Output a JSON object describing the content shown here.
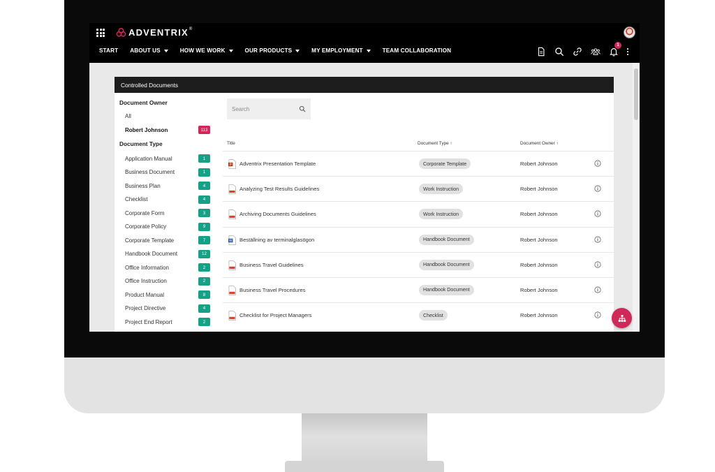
{
  "app": {
    "brand": "ADVENTRIX",
    "trademark": "®"
  },
  "nav": {
    "items": [
      {
        "label": "START",
        "dropdown": false
      },
      {
        "label": "ABOUT US",
        "dropdown": true
      },
      {
        "label": "HOW WE WORK",
        "dropdown": true
      },
      {
        "label": "OUR PRODUCTS",
        "dropdown": true
      },
      {
        "label": "MY EMPLOYMENT",
        "dropdown": true
      },
      {
        "label": "TEAM COLLABORATION",
        "dropdown": false
      }
    ],
    "tools": [
      "document-icon",
      "search-icon",
      "link-icon",
      "people-icon",
      "bell-icon",
      "more-vertical-icon"
    ],
    "notification_count": "1"
  },
  "panel": {
    "title": "Controlled Documents",
    "filters": {
      "owner_heading": "Document Owner",
      "owner_all": "All",
      "owner_selected": {
        "label": "Robert Johnson",
        "count": "113"
      },
      "type_heading": "Document Type",
      "types": [
        {
          "label": "Application Manual",
          "count": "1"
        },
        {
          "label": "Business Document",
          "count": "1"
        },
        {
          "label": "Business Plan",
          "count": "4"
        },
        {
          "label": "Checklist",
          "count": "4"
        },
        {
          "label": "Corporate Form",
          "count": "3"
        },
        {
          "label": "Corporate Policy",
          "count": "9"
        },
        {
          "label": "Corporate Template",
          "count": "7"
        },
        {
          "label": "Handbook Document",
          "count": "12"
        },
        {
          "label": "Office Information",
          "count": "2"
        },
        {
          "label": "Office Instruction",
          "count": "2"
        },
        {
          "label": "Product Manual",
          "count": "8"
        },
        {
          "label": "Project Directive",
          "count": "4"
        },
        {
          "label": "Project End Report",
          "count": "2"
        }
      ]
    },
    "search": {
      "placeholder": "Search"
    },
    "columns": {
      "title": "Title",
      "type": "Document Type ↑",
      "owner": "Document Owner ↑"
    },
    "rows": [
      {
        "title": "Adventrix Presentation Template",
        "type": "Corporate Template",
        "owner": "Robert Johnson",
        "icon": "powerpoint-file-icon"
      },
      {
        "title": "Analyzing Test Results Guidelines",
        "type": "Work Instruction",
        "owner": "Robert Johnson",
        "icon": "pdf-file-icon"
      },
      {
        "title": "Archiving Documents Guidelines",
        "type": "Work Instruction",
        "owner": "Robert Johnson",
        "icon": "pdf-file-icon"
      },
      {
        "title": "Beställning av terminalglasögon",
        "type": "Handbook Document",
        "owner": "Robert Johnson",
        "icon": "word-file-icon"
      },
      {
        "title": "Business Travel Guidelines",
        "type": "Handbook Document",
        "owner": "Robert Johnson",
        "icon": "pdf-file-icon"
      },
      {
        "title": "Business Travel Procedures",
        "type": "Handbook Document",
        "owner": "Robert Johnson",
        "icon": "pdf-file-icon"
      },
      {
        "title": "Checklist for Project Managers",
        "type": "Checklist",
        "owner": "Robert Johnson",
        "icon": "pdf-file-icon"
      }
    ]
  },
  "colors": {
    "accent": "#d1285a",
    "count_badge": "#16a085",
    "header": "#1d1d1d",
    "topbar": "#000000"
  }
}
